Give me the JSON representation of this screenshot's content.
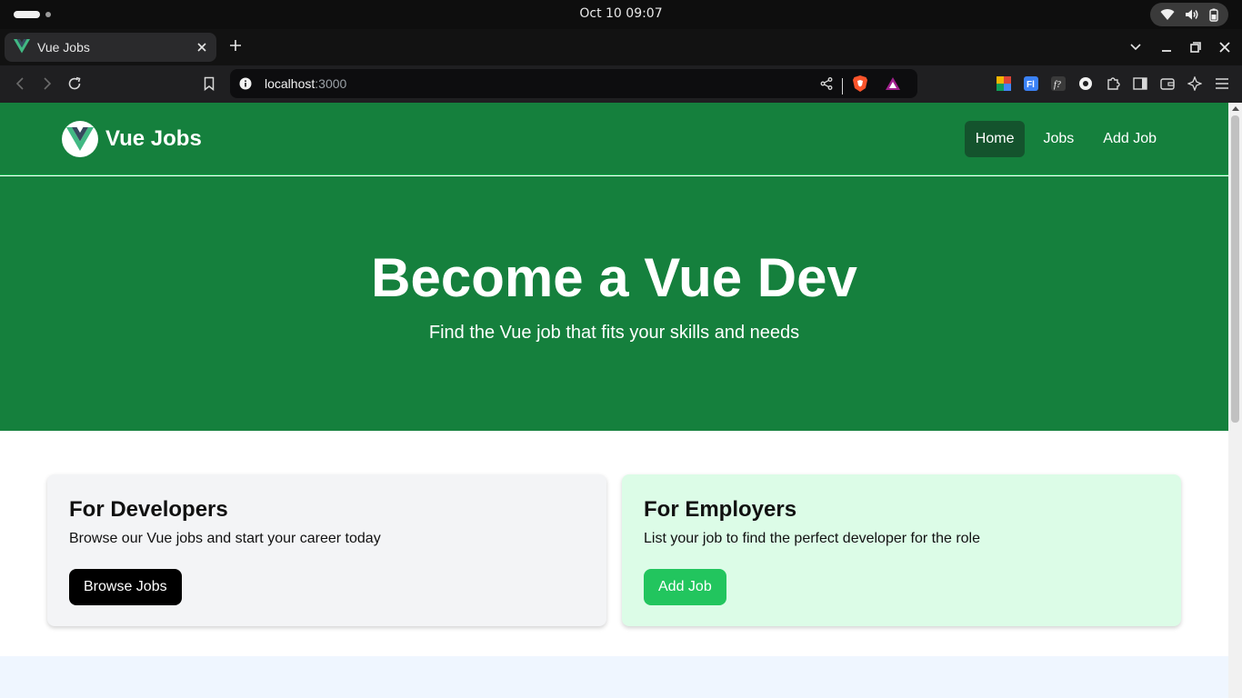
{
  "os": {
    "clock": "Oct 10  09:07"
  },
  "browser": {
    "tab": {
      "title": "Vue Jobs"
    },
    "url": {
      "host": "localhost",
      "port": ":3000"
    }
  },
  "page": {
    "brand": {
      "name": "Vue Jobs"
    },
    "nav": [
      {
        "label": "Home",
        "active": true
      },
      {
        "label": "Jobs"
      },
      {
        "label": "Add Job"
      }
    ],
    "hero": {
      "title": "Become a Vue Dev",
      "subtitle": "Find the Vue job that fits your skills and needs"
    },
    "cards": {
      "developers": {
        "title": "For Developers",
        "text": "Browse our Vue jobs and start your career today",
        "button": "Browse Jobs"
      },
      "employers": {
        "title": "For Employers",
        "text": "List your job to find the perfect developer for the role",
        "button": "Add Job"
      }
    }
  },
  "colors": {
    "brand_green": "#15803d",
    "active_nav": "#14532d",
    "button_green": "#22c55e",
    "employer_card": "#dcfce7",
    "developer_card": "#f3f4f6"
  }
}
